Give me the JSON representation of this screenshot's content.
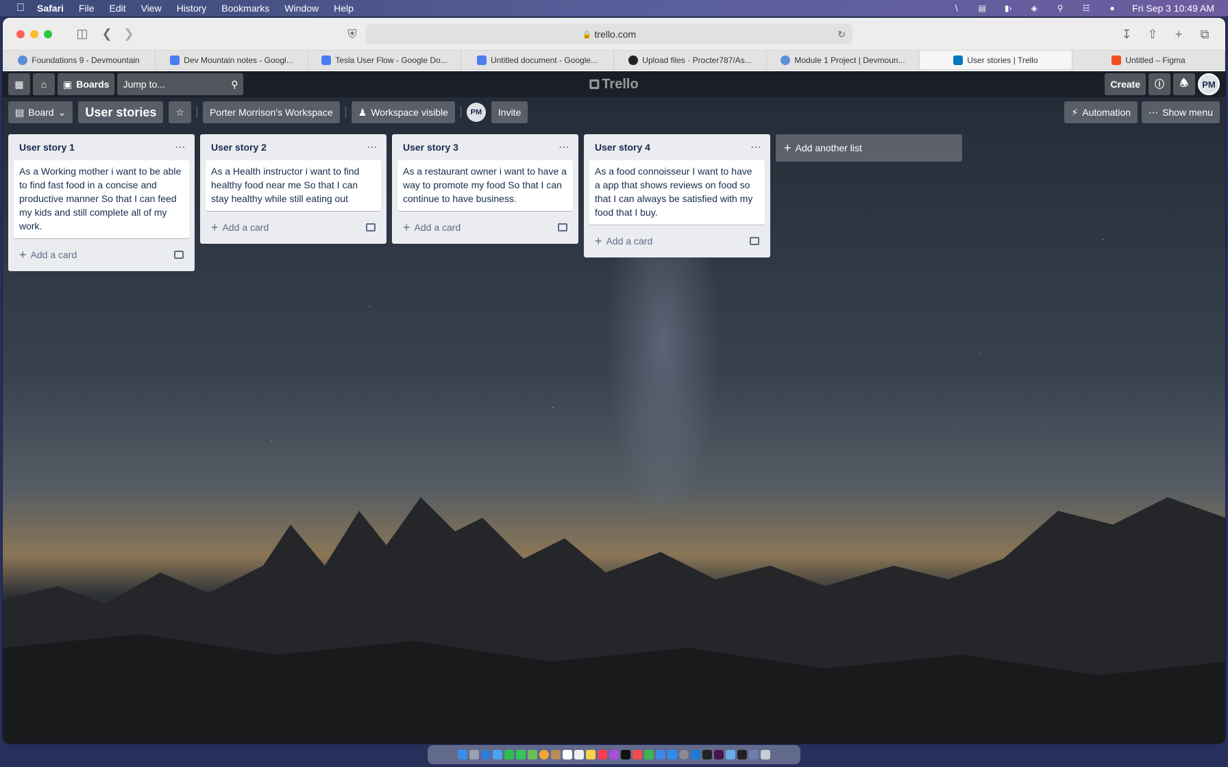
{
  "menubar": {
    "app_name": "Safari",
    "items": [
      "File",
      "Edit",
      "View",
      "History",
      "Bookmarks",
      "Window",
      "Help"
    ],
    "datetime": "Fri Sep 3  10:49 AM"
  },
  "browser": {
    "url": "trello.com",
    "tabs": [
      {
        "label": "Foundations 9 - Devmountain",
        "icon_color": "#5b8fd6"
      },
      {
        "label": "Dev Mountain notes - Googl...",
        "icon_color": "#4a7ef0"
      },
      {
        "label": "Tesla User Flow - Google Do...",
        "icon_color": "#4a7ef0"
      },
      {
        "label": "Untitled document - Google...",
        "icon_color": "#4a7ef0"
      },
      {
        "label": "Upload files · Procter787/As...",
        "icon_color": "#222222"
      },
      {
        "label": "Module 1 Project | Devmoun...",
        "icon_color": "#5b8fd6"
      },
      {
        "label": "User stories | Trello",
        "icon_color": "#0079bf"
      },
      {
        "label": "Untitled – Figma",
        "icon_color": "#f24e1e"
      }
    ],
    "active_tab": 6
  },
  "trello": {
    "nav": {
      "boards_label": "Boards",
      "jump_placeholder": "Jump to...",
      "logo_text": "Trello",
      "create_label": "Create",
      "user_initials": "PM"
    },
    "board": {
      "view_label": "Board",
      "title": "User stories",
      "workspace_label": "Porter Morrison's Workspace",
      "visibility_label": "Workspace visible",
      "member_initials": "PM",
      "invite_label": "Invite",
      "automation_label": "Automation",
      "show_menu_label": "Show menu"
    },
    "lists": [
      {
        "title": "User story 1",
        "cards": [
          "As a Working mother i want to be able to find fast food in a concise and productive manner So that I can feed my kids and still complete all of my work."
        ],
        "add_card_label": "Add a card"
      },
      {
        "title": "User story 2",
        "cards": [
          "As a Health instructor i want to find healthy food near me So that I can stay healthy while still eating out"
        ],
        "add_card_label": "Add a card"
      },
      {
        "title": "User story 3",
        "cards": [
          "As a restaurant owner i want to have a way to promote my food So that I can continue to have business."
        ],
        "add_card_label": "Add a card"
      },
      {
        "title": "User story 4",
        "cards": [
          "As a food connoisseur I want to have a app that shows reviews on food so that I can always be satisfied with my food that I buy."
        ],
        "add_card_label": "Add a card"
      }
    ],
    "add_list_label": "Add another list"
  }
}
